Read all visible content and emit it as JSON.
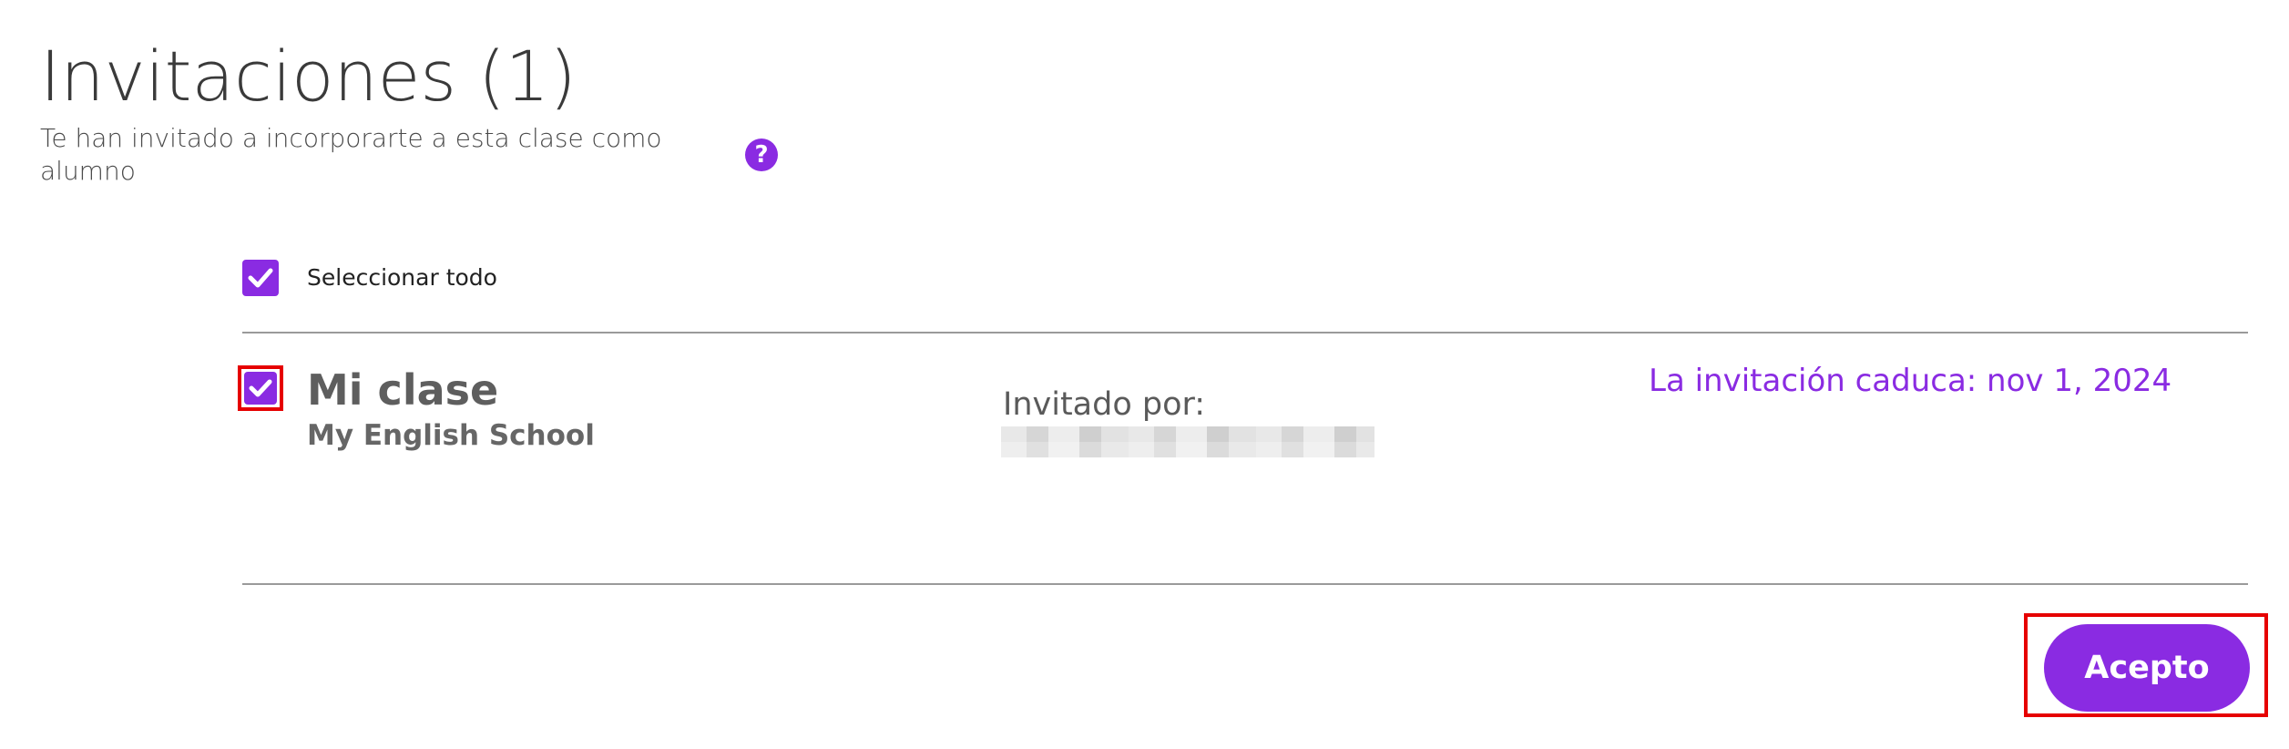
{
  "header": {
    "title": "Invitaciones (1)",
    "subtitle": "Te han invitado a incorporarte a esta clase como alumno",
    "help_icon": "question-circle-icon",
    "help_symbol": "?"
  },
  "selection": {
    "select_all_label": "Seleccionar todo",
    "select_all_checked": true
  },
  "invitations": [
    {
      "checked": true,
      "class_name": "Mi clase",
      "school_name": "My English School",
      "invited_by_label": "Invitado por:",
      "expiry": "La invitación caduca: nov 1, 2024"
    }
  ],
  "actions": {
    "accept_label": "Acepto"
  },
  "colors": {
    "accent": "#8a2be2",
    "highlight_border": "#e60000",
    "divider": "#9a9a9a",
    "text": "#3a3a3a"
  }
}
